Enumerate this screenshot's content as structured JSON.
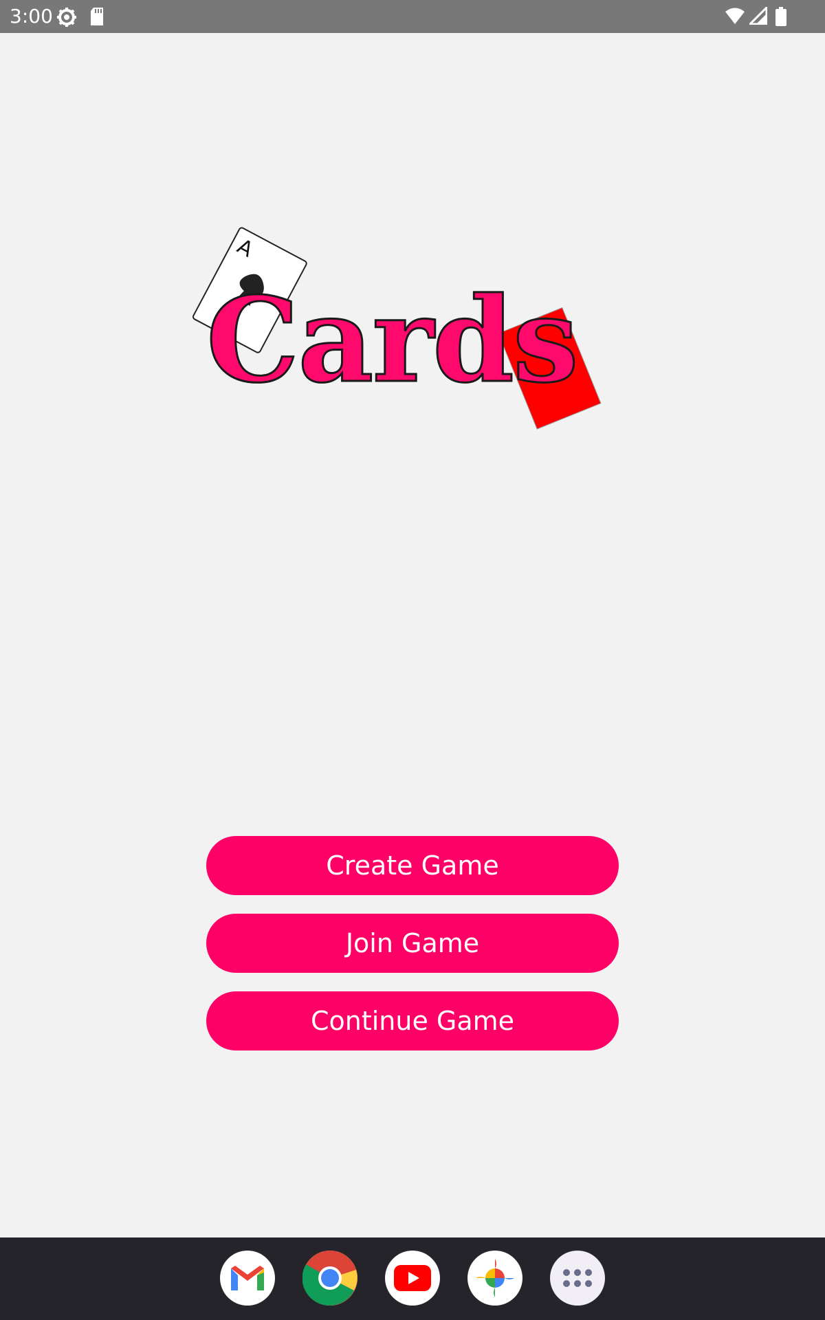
{
  "status_bar": {
    "time": "3:00",
    "icons": [
      "settings-icon",
      "sd-card-icon",
      "wifi-icon",
      "signal-icon",
      "battery-icon"
    ]
  },
  "logo": {
    "text": "Cards",
    "card_rank": "A",
    "colors": {
      "text": "#ff0a6c",
      "red_card": "#ff0000"
    }
  },
  "menu": {
    "create_label": "Create Game",
    "join_label": "Join Game",
    "continue_label": "Continue Game",
    "button_color": "#ff0066"
  },
  "dock": {
    "apps": [
      "gmail-icon",
      "chrome-icon",
      "youtube-icon",
      "photos-icon",
      "app-drawer-icon"
    ]
  }
}
